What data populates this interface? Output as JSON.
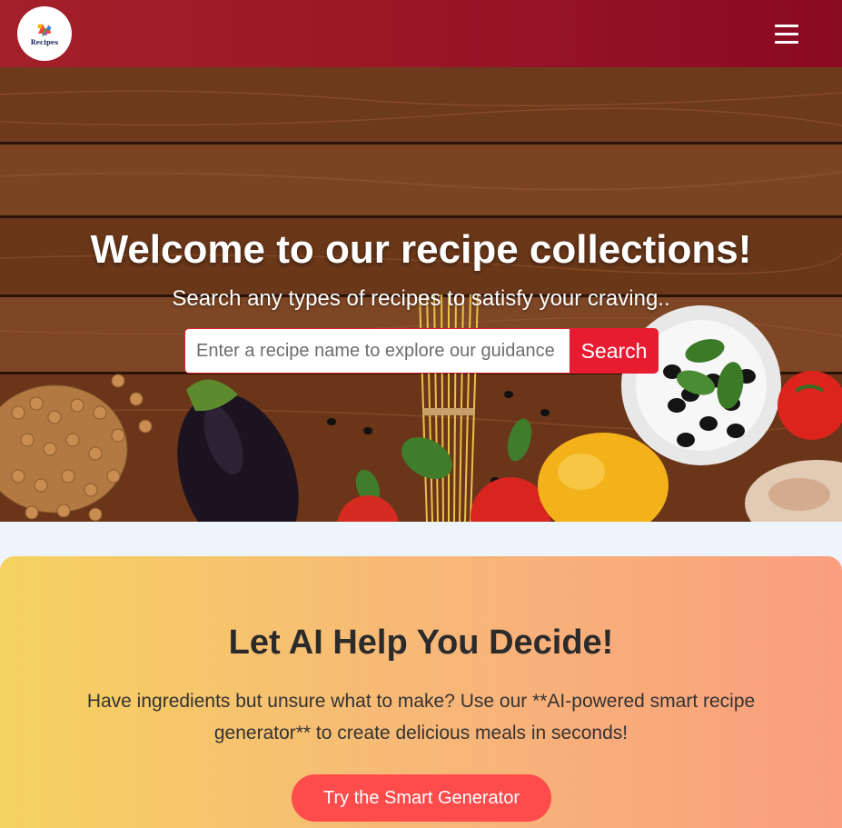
{
  "header": {
    "logo_text": "Recipes",
    "menu_icon": "hamburger-menu-icon"
  },
  "hero": {
    "title": "Welcome to our recipe collections!",
    "subtitle": "Search any types of recipes to satisfy your craving..",
    "search": {
      "placeholder": "Enter a recipe name to explore our guidance",
      "value": "",
      "button_label": "Search"
    }
  },
  "ai_section": {
    "title": "Let AI Help You Decide!",
    "description": "Have ingredients but unsure what to make? Use our **AI-powered smart recipe generator** to create delicious meals in seconds!",
    "button_label": "Try the Smart Generator"
  },
  "colors": {
    "header_gradient": [
      "#a3202a",
      "#8a0a22"
    ],
    "search_button": "#e81c31",
    "ai_gradient": [
      "#f5d260",
      "#fa9e7e"
    ],
    "ai_button": "#fe4b4b",
    "page_background": "#eef4fb"
  }
}
